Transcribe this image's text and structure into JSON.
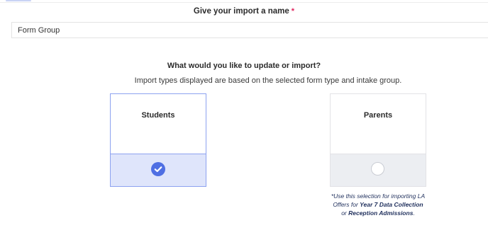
{
  "import_name": {
    "label": "Give your import a name",
    "required_mark": "*",
    "value": "Form Group"
  },
  "import_type": {
    "title": "What would you like to update or import?",
    "subtitle": "Import types displayed are based on the selected form type and intake group.",
    "options": [
      {
        "label": "Students",
        "selected": true,
        "icon": "check-circle-icon"
      },
      {
        "label": "Parents",
        "selected": false,
        "icon": "radio-empty-icon"
      }
    ],
    "parents_note": {
      "part1": "*Use this selection for importing LA Offers for ",
      "bold1": "Year 7 Data Collection",
      "part2": " or ",
      "bold2": "Reception Admissions",
      "part3": "."
    }
  },
  "colors": {
    "accent": "#4f6fe3",
    "selected_border": "#8da2f0",
    "selected_fill": "#dfe5fb",
    "required": "#e0245e",
    "note_text": "#1f2f5c"
  }
}
